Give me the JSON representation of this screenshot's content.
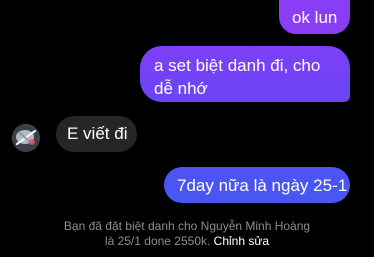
{
  "messages": {
    "sent_ok": "ok lun",
    "sent_set_nickname": "a set biệt danh đi, cho dễ nhớ",
    "received_write": "E viết đi",
    "sent_7day": "7day nữa là ngày 25-1"
  },
  "system_notice": {
    "line1": "Bạn đã đặt biệt danh cho Nguyễn Minh Hoàng",
    "line2": "là 25/1 done 2550k.",
    "edit_link": "Chỉnh sửa"
  },
  "colors": {
    "background": "#000000",
    "outgoing_bubble_top": "#8a3df6",
    "outgoing_bubble_bottom": "#4657f2",
    "incoming_bubble": "#262628",
    "system_text": "#8e8e93"
  },
  "icons": {
    "avatar": "contact-avatar"
  }
}
